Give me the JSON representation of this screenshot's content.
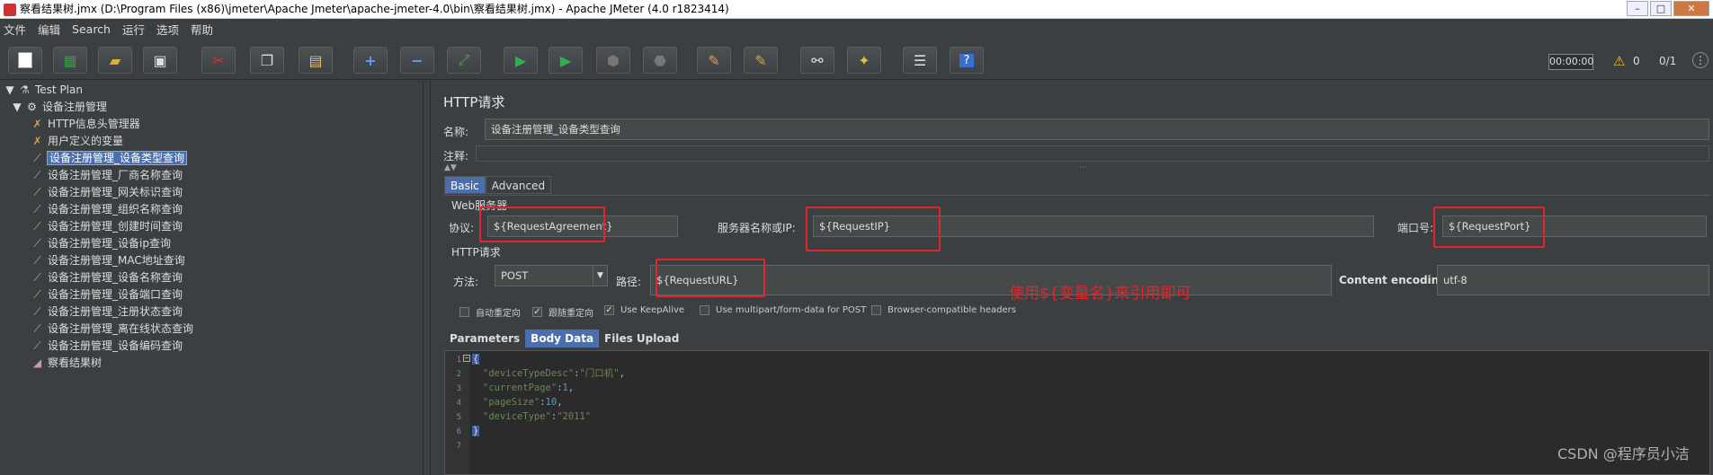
{
  "window": {
    "title": "察看结果树.jmx (D:\\Program Files (x86)\\jmeter\\Apache Jmeter\\apache-jmeter-4.0\\bin\\察看结果树.jmx) - Apache JMeter (4.0 r1823414)",
    "minimize": "–",
    "maximize": "□",
    "close": "✕"
  },
  "menu": [
    "文件",
    "编辑",
    "Search",
    "运行",
    "选项",
    "帮助"
  ],
  "status": {
    "timer": "00:00:00",
    "warnings": "0",
    "threads": "0/1"
  },
  "tree": {
    "items": [
      {
        "label": "Test Plan",
        "icon": "test-plan-icon"
      },
      {
        "label": "设备注册管理",
        "icon": "gear-icon"
      },
      {
        "label": "HTTP信息头管理器",
        "icon": "wrench-icon"
      },
      {
        "label": "用户定义的变量",
        "icon": "wrench-icon"
      },
      {
        "label": "设备注册管理_设备类型查询",
        "icon": "pipette-icon"
      },
      {
        "label": "设备注册管理_厂商名称查询",
        "icon": "pipette-icon"
      },
      {
        "label": "设备注册管理_网关标识查询",
        "icon": "pipette-icon"
      },
      {
        "label": "设备注册管理_组织名称查询",
        "icon": "pipette-icon"
      },
      {
        "label": "设备注册管理_创建时间查询",
        "icon": "pipette-icon"
      },
      {
        "label": "设备注册管理_设备ip查询",
        "icon": "pipette-icon"
      },
      {
        "label": "设备注册管理_MAC地址查询",
        "icon": "pipette-icon"
      },
      {
        "label": "设备注册管理_设备名称查询",
        "icon": "pipette-icon"
      },
      {
        "label": "设备注册管理_设备端口查询",
        "icon": "pipette-icon"
      },
      {
        "label": "设备注册管理_注册状态查询",
        "icon": "pipette-icon"
      },
      {
        "label": "设备注册管理_离在线状态查询",
        "icon": "pipette-icon"
      },
      {
        "label": "设备注册管理_设备编码查询",
        "icon": "pipette-icon"
      },
      {
        "label": "察看结果树",
        "icon": "chart-icon"
      }
    ]
  },
  "panel": {
    "title": "HTTP请求",
    "name_label": "名称:",
    "name_value": "设备注册管理_设备类型查询",
    "comment_label": "注释:",
    "tabs": [
      "Basic",
      "Advanced"
    ],
    "web_server_title": "Web服务器",
    "protocol_label": "协议:",
    "protocol_value": "${RequestAgreement}",
    "server_label": "服务器名称或IP:",
    "server_value": "${RequestIP}",
    "port_label": "端口号:",
    "port_value": "${RequestPort}",
    "http_request_title": "HTTP请求",
    "method_label": "方法:",
    "method_value": "POST",
    "path_label": "路径:",
    "path_value": "${RequestURL}",
    "encoding_label": "Content encoding:",
    "encoding_value": "utf-8",
    "annotation": "使用${变量名}来引用即可",
    "checkboxes": [
      {
        "label": "自动重定向",
        "checked": false
      },
      {
        "label": "跟随重定向",
        "checked": true
      },
      {
        "label": "Use KeepAlive",
        "checked": true
      },
      {
        "label": "Use multipart/form-data for POST",
        "checked": false
      },
      {
        "label": "Browser-compatible headers",
        "checked": false
      }
    ],
    "body_tabs": [
      "Parameters",
      "Body Data",
      "Files Upload"
    ],
    "code_lines": [
      "1",
      "2",
      "3",
      "4",
      "5",
      "6",
      "7"
    ],
    "code": {
      "l1": "{",
      "l2_key": "\"deviceTypeDesc\"",
      "l2_val": "\"门口机\"",
      "l3_key": "\"currentPage\"",
      "l3_val": "1",
      "l4_key": "\"pageSize\"",
      "l4_val": "10",
      "l5_key": "\"deviceType\"",
      "l5_val": "\"2011\"",
      "l6": "}"
    }
  },
  "watermark": "CSDN @程序员小洁"
}
